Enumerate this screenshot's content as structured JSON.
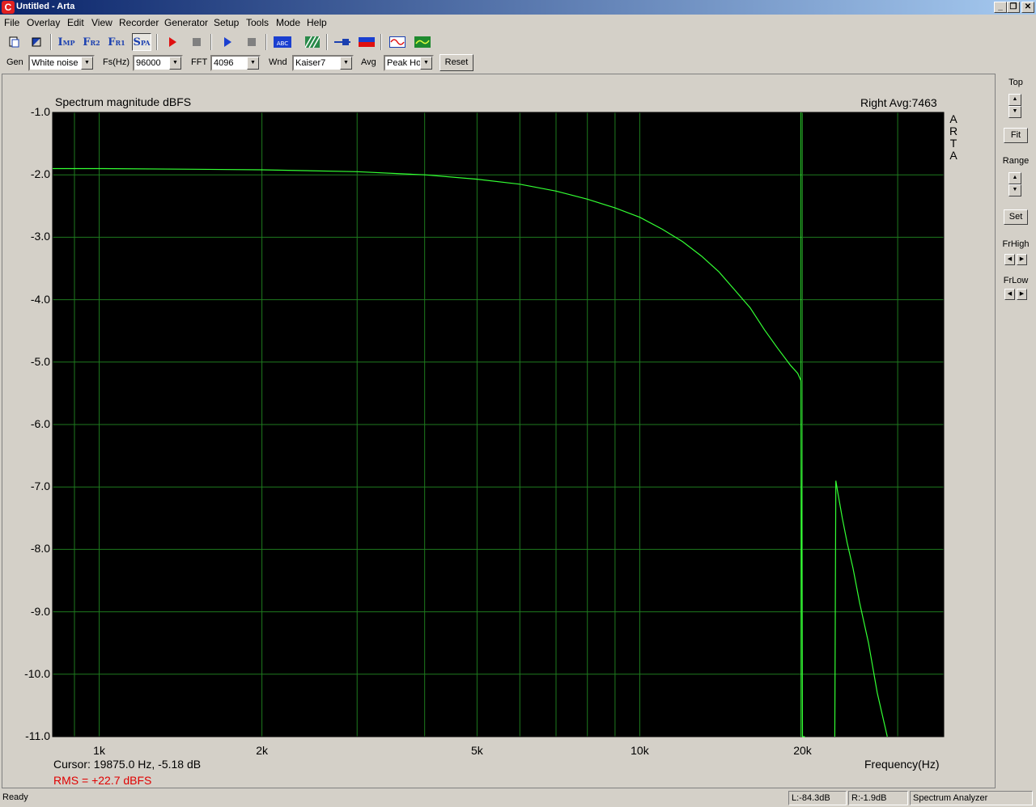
{
  "window": {
    "title": "Untitled - Arta",
    "app_icon": "C",
    "minimize": "_",
    "restore": "❐",
    "close": "✕"
  },
  "menu": [
    "File",
    "Overlay",
    "Edit",
    "View",
    "Recorder",
    "Generator",
    "Setup",
    "Tools",
    "Mode",
    "Help"
  ],
  "toolbar": {
    "buttons": [
      {
        "name": "new-file-icon"
      },
      {
        "name": "open-file-icon"
      },
      {
        "label_main": "I",
        "label_sub": "MP",
        "name": "impulse-mode-button"
      },
      {
        "label_main": "F",
        "label_sub": "R2",
        "name": "fr2-mode-button"
      },
      {
        "label_main": "F",
        "label_sub": "R1",
        "name": "fr1-mode-button"
      },
      {
        "label_main": "S",
        "label_sub": "PA",
        "name": "spa-mode-button"
      },
      {
        "name": "record-icon"
      },
      {
        "name": "stop-record-icon"
      },
      {
        "name": "play-icon"
      },
      {
        "name": "stop-play-icon"
      },
      {
        "name": "abc-icon",
        "label": "ABC"
      },
      {
        "name": "hatch-icon"
      },
      {
        "name": "slider-icon"
      },
      {
        "name": "meter-icon"
      },
      {
        "name": "signal-icon"
      },
      {
        "name": "scope-icon"
      }
    ]
  },
  "params": {
    "gen_label": "Gen",
    "gen_value": "White noise",
    "fs_label": "Fs(Hz)",
    "fs_value": "96000",
    "fft_label": "FFT",
    "fft_value": "4096",
    "wnd_label": "Wnd",
    "wnd_value": "Kaiser7",
    "avg_label": "Avg",
    "avg_value": "Peak Hol",
    "reset_label": "Reset"
  },
  "plot": {
    "title": "Spectrum magnitude dBFS",
    "status": "Right  Avg:7463",
    "vertical_text": [
      "A",
      "R",
      "T",
      "A"
    ],
    "cursor_readout": "Cursor:  19875.0 Hz, -5.18 dB",
    "rms_readout": "RMS =  +22.7 dBFS"
  },
  "side": {
    "top_label": "Top",
    "fit_label": "Fit",
    "range_label": "Range",
    "set_label": "Set",
    "frhigh_label": "FrHigh",
    "frlow_label": "FrLow",
    "up": "▲",
    "down": "▼",
    "left": "◀",
    "right": "▶"
  },
  "status": {
    "ready": "Ready",
    "left_level": "L:-84.3dB",
    "right_level": "R:-1.9dB",
    "mode": "Spectrum Analyzer"
  },
  "chart_data": {
    "type": "line",
    "title": "Spectrum magnitude dBFS",
    "xlabel": "Frequency(Hz)",
    "ylabel": "",
    "xscale": "log",
    "xlim": [
      820,
      36500
    ],
    "ylim": [
      -11.0,
      -1.0
    ],
    "yticks": [
      -1.0,
      -2.0,
      -3.0,
      -4.0,
      -5.0,
      -6.0,
      -7.0,
      -8.0,
      -9.0,
      -10.0,
      -11.0
    ],
    "ytick_labels": [
      "-1.0",
      "-2.0",
      "-3.0",
      "-4.0",
      "-5.0",
      "-6.0",
      "-7.0",
      "-8.0",
      "-9.0",
      "-10.0",
      "-11.0"
    ],
    "xticks": [
      1000,
      2000,
      5000,
      10000,
      20000
    ],
    "xtick_labels": [
      "1k",
      "2k",
      "5k",
      "10k",
      "20k"
    ],
    "grid": true,
    "background": "#000000",
    "grid_color": "#1e7a1e",
    "line_color": "#33ff33",
    "cursor_x": 19875,
    "series": [
      {
        "x": [
          820,
          1000,
          1500,
          2000,
          3000,
          4000,
          5000,
          6000,
          7000,
          8000,
          9000,
          10000,
          11000,
          12000,
          13000,
          14000,
          15000,
          16000,
          17000,
          18000,
          19000,
          19600,
          19875,
          20000,
          20100,
          20200
        ],
        "values": [
          -1.9,
          -1.9,
          -1.91,
          -1.92,
          -1.95,
          -2.0,
          -2.07,
          -2.15,
          -2.26,
          -2.39,
          -2.53,
          -2.68,
          -2.87,
          -3.07,
          -3.3,
          -3.55,
          -3.85,
          -4.13,
          -4.48,
          -4.78,
          -5.05,
          -5.18,
          -5.3,
          -11.0,
          -11.0,
          -11.0
        ]
      },
      {
        "x": [
          22950,
          23050,
          23200,
          23700,
          24200,
          24800,
          25500,
          26500,
          27500,
          28700
        ],
        "values": [
          -11.0,
          -6.9,
          -7.05,
          -7.5,
          -7.9,
          -8.3,
          -8.85,
          -9.5,
          -10.3,
          -11.0
        ]
      }
    ]
  }
}
